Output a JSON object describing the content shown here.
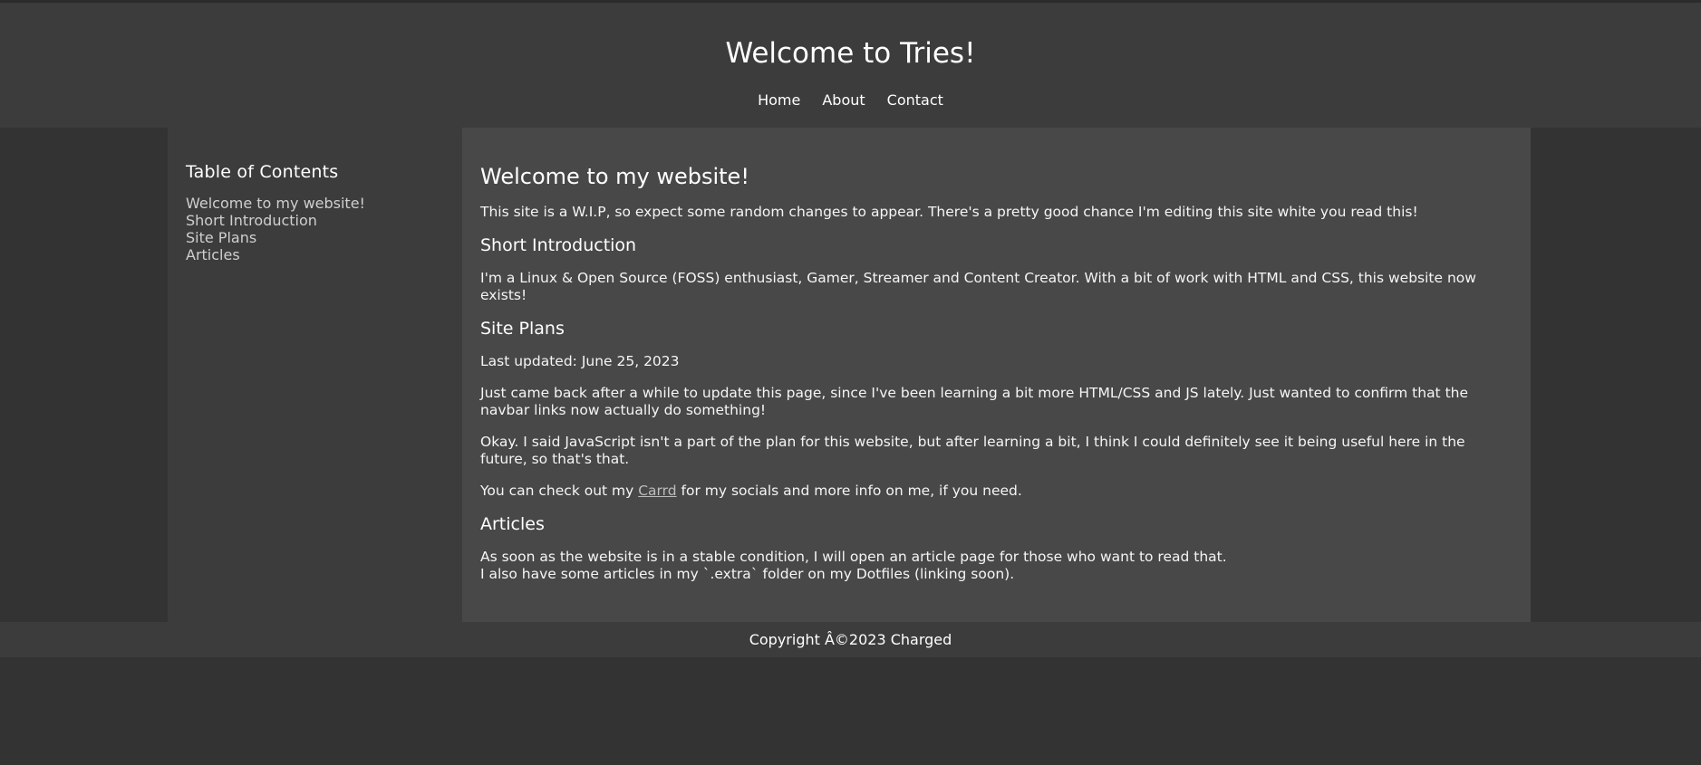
{
  "header": {
    "title": "Welcome to Tries!",
    "nav": [
      "Home",
      "About",
      "Contact"
    ]
  },
  "sidebar": {
    "title": "Table of Contents",
    "items": [
      "Welcome to my website!",
      "Short Introduction",
      "Site Plans",
      "Articles"
    ]
  },
  "main": {
    "heading": "Welcome to my website!",
    "intro": "This site is a W.I.P, so expect some random changes to appear. There's a pretty good chance I'm editing this site white you read this!",
    "short_intro": {
      "heading": "Short Introduction",
      "text": "I'm a Linux & Open Source (FOSS) enthusiast, Gamer, Streamer and Content Creator. With a bit of work with HTML and CSS, this website now exists!"
    },
    "site_plans": {
      "heading": "Site Plans",
      "updated": "Last updated: June 25, 2023",
      "p1": "Just came back after a while to update this page, since I've been learning a bit more HTML/CSS and JS lately. Just wanted to confirm that the navbar links now actually do something!",
      "p2": "Okay. I said JavaScript isn't a part of the plan for this website, but after learning a bit, I think I could definitely see it being useful here in the future, so that's that.",
      "p3_before": "You can check out my ",
      "p3_link": "Carrd",
      "p3_after": " for my socials and more info on me, if you need."
    },
    "articles": {
      "heading": "Articles",
      "line1": "As soon as the website is in a stable condition, I will open an article page for those who want to read that.",
      "line2": "I also have some articles in my `.extra` folder on my Dotfiles (linking soon)."
    }
  },
  "footer": {
    "text": "Copyright Â©2023 Charged"
  }
}
